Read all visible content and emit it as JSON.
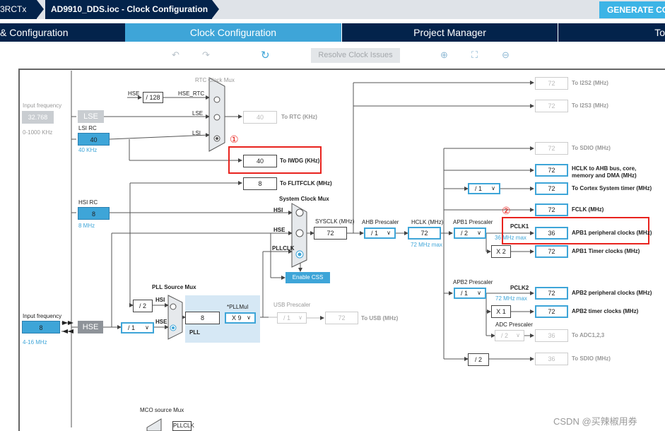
{
  "breadcrumb": [
    "3RCTx",
    "AD9910_DDS.ioc - Clock Configuration"
  ],
  "generate_button": "GENERATE CO",
  "tabs": [
    "& Configuration",
    "Clock Configuration",
    "Project Manager",
    "To"
  ],
  "toolbar": {
    "resolve": "Resolve Clock Issues"
  },
  "input_freq": {
    "label": "Input frequency",
    "value": "32.768",
    "range": "0-1000 KHz"
  },
  "lse": "LSE",
  "lsi": {
    "label": "LSI RC",
    "value": "40",
    "unit": "40 KHz"
  },
  "hsi": {
    "label": "HSI RC",
    "value": "8",
    "unit": "8 MHz"
  },
  "hse_input": {
    "label": "Input frequency",
    "value": "8",
    "range": "4-16 MHz"
  },
  "hse_block": "HSE",
  "rtc_mux": {
    "title": "RTC Clock Mux",
    "hse": "HSE",
    "div": "/ 128",
    "hse_rtc": "HSE_RTC",
    "lse": "LSE",
    "lsi": "LSI"
  },
  "rtc_out": {
    "value": "40",
    "label": "To RTC (KHz)"
  },
  "iwdg_out": {
    "value": "40",
    "label": "To IWDG (KHz)"
  },
  "flitf_out": {
    "value": "8",
    "label": "To FLITFCLK (MHz)"
  },
  "sys_mux": {
    "title": "System Clock Mux",
    "hsi": "HSI",
    "hse": "HSE",
    "pllclk": "PLLCLK"
  },
  "enable_css": "Enable CSS",
  "sysclk": {
    "label": "SYSCLK (MHz)",
    "value": "72"
  },
  "ahb": {
    "label": "AHB Prescaler",
    "value": "/ 1"
  },
  "hclk": {
    "label": "HCLK (MHz)",
    "value": "72",
    "max": "72 MHz max"
  },
  "apb1": {
    "label": "APB1 Prescaler",
    "value": "/ 2",
    "pclk": "PCLK1",
    "max": "36 MHz max",
    "x2": "X 2"
  },
  "apb2": {
    "label": "APB2 Prescaler",
    "value": "/ 1",
    "pclk": "PCLK2",
    "max": "72 MHz max",
    "x1": "X 1"
  },
  "adc": {
    "label": "ADC Prescaler",
    "value": "/ 2"
  },
  "cortex_div": "/ 1",
  "sdio_div": "/ 2",
  "outputs": [
    {
      "value": "72",
      "label": "To I2S2 (MHz)"
    },
    {
      "value": "72",
      "label": "To I2S3 (MHz)"
    },
    {
      "value": "72",
      "label": "To SDIO (MHz)"
    },
    {
      "value": "72",
      "label": "HCLK to AHB bus, core,",
      "label2": "memory and DMA (MHz)"
    },
    {
      "value": "72",
      "label": "To Cortex System timer (MHz)"
    },
    {
      "value": "72",
      "label": "FCLK (MHz)"
    },
    {
      "value": "36",
      "label": "APB1 peripheral clocks (MHz)"
    },
    {
      "value": "72",
      "label": "APB1 Timer clocks (MHz)"
    },
    {
      "value": "72",
      "label": "APB2 peripheral clocks (MHz)"
    },
    {
      "value": "72",
      "label": "APB2 timer clocks (MHz)"
    },
    {
      "value": "36",
      "label": "To ADC1,2,3"
    },
    {
      "value": "36",
      "label": "To SDIO (MHz)"
    }
  ],
  "pll_mux": {
    "title": "PLL Source Mux",
    "div": "/ 2",
    "hsi": "HSI",
    "hse": "HSE"
  },
  "pll": {
    "value": "8",
    "label": "PLL",
    "mul_label": "*PLLMul",
    "mul": "X 9"
  },
  "usb": {
    "label": "USB Prescaler",
    "value": "/ 1",
    "out": "72",
    "out_label": "To USB (MHz)"
  },
  "hse_div": "/ 1",
  "mco": {
    "title": "MCO source Mux",
    "pllclk": "PLLCLK"
  },
  "annotations": [
    "①",
    "②"
  ],
  "watermark": "CSDN @买辣椒用券",
  "colors": {
    "navy": "#03234b",
    "accent": "#3ea5d8",
    "highlight": "#e8231e"
  }
}
